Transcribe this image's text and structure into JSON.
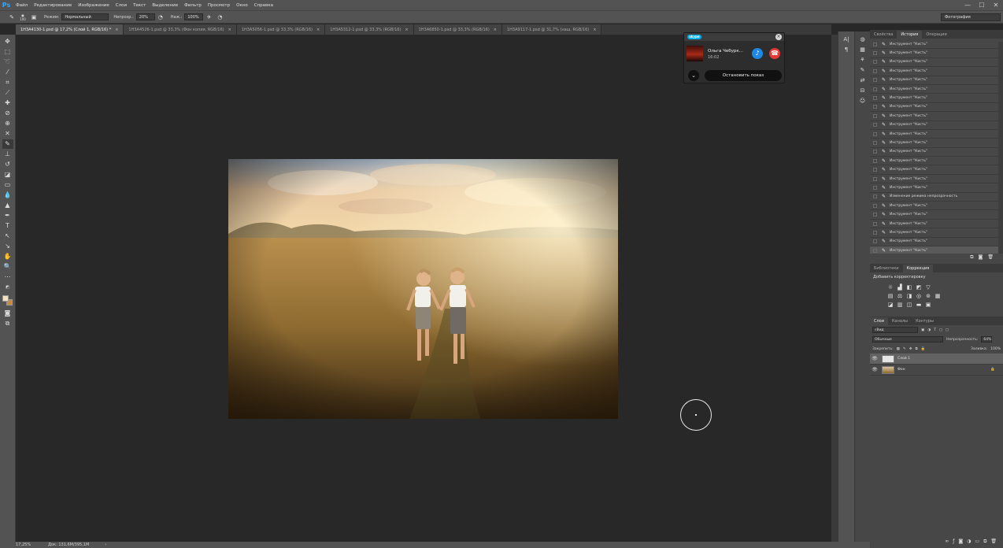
{
  "app": {
    "logo": "Ps"
  },
  "menu": [
    "Файл",
    "Редактирование",
    "Изображение",
    "Слои",
    "Текст",
    "Выделение",
    "Фильтр",
    "Просмотр",
    "Окно",
    "Справка"
  ],
  "window_controls": {
    "minimize": "—",
    "maximize": "☐",
    "close": "✕"
  },
  "options": {
    "brush_size": "100",
    "mode_label": "Режим:",
    "mode_value": "Нормальный",
    "opacity_label": "Непрозр.:",
    "opacity_value": "20%",
    "flow_label": "Наж.:",
    "flow_value": "100%",
    "workspace": "Фотография"
  },
  "tabs": [
    {
      "label": "1H3A4130-1.psd @ 17,2% (Слой 1, RGB/16) *",
      "close": "×"
    },
    {
      "label": "1H3A4526-1.psd @ 33,3% (Фон копия, RGB/16)",
      "close": "×"
    },
    {
      "label": "1H3A5056-1.psd @ 33,3% (RGB/16)",
      "close": "×"
    },
    {
      "label": "1H3A5312-1.psd @ 33,3% (RGB/16)",
      "close": "×"
    },
    {
      "label": "1H3A6850-1.psd @ 33,3% (RGB/16)",
      "close": "×"
    },
    {
      "label": "1H3A9117-1.psd @ 31,7% (наш, RGB/16)",
      "close": "×"
    }
  ],
  "status": {
    "zoom": "17,25%",
    "doc": "Док: 131,6M/395,1M",
    "arrow": "›"
  },
  "skype": {
    "logo": "skype",
    "close": "×",
    "caller": "Ольга Чебурк...",
    "time": "16:02",
    "mic": "♪",
    "hangup": "☎",
    "more": "⌄",
    "stop_button": "Остановить показ"
  },
  "panel_tabs_top": [
    "Свойства",
    "История",
    "Операции"
  ],
  "history": {
    "items": [
      "Инструмент \"Кисть\"",
      "Инструмент \"Кисть\"",
      "Инструмент \"Кисть\"",
      "Инструмент \"Кисть\"",
      "Инструмент \"Кисть\"",
      "Инструмент \"Кисть\"",
      "Инструмент \"Кисть\"",
      "Инструмент \"Кисть\"",
      "Инструмент \"Кисть\"",
      "Инструмент \"Кисть\"",
      "Инструмент \"Кисть\"",
      "Инструмент \"Кисть\"",
      "Инструмент \"Кисть\"",
      "Инструмент \"Кисть\"",
      "Инструмент \"Кисть\"",
      "Инструмент \"Кисть\"",
      "Инструмент \"Кисть\"",
      "Изменение режима непрозрачность",
      "Инструмент \"Кисть\"",
      "Инструмент \"Кисть\"",
      "Инструмент \"Кисть\"",
      "Инструмент \"Кисть\"",
      "Инструмент \"Кисть\"",
      "Инструмент \"Кисть\""
    ]
  },
  "panel_tabs_mid": [
    "Библиотеки",
    "Коррекция"
  ],
  "adjustments": {
    "title": "Добавить корректировку"
  },
  "panel_tabs_layers": [
    "Слои",
    "Каналы",
    "Контуры"
  ],
  "layers": {
    "filter_label": "Вид",
    "blend_mode": "Обычные",
    "opacity_label": "Непрозрачность:",
    "opacity_value": "64%",
    "lock_label": "Закрепить:",
    "fill_label": "Заливка:",
    "fill_value": "100%",
    "items": [
      {
        "name": "Слой 1",
        "eye": "👁",
        "lock": ""
      },
      {
        "name": "Фон",
        "eye": "👁",
        "lock": "🔒"
      }
    ]
  }
}
